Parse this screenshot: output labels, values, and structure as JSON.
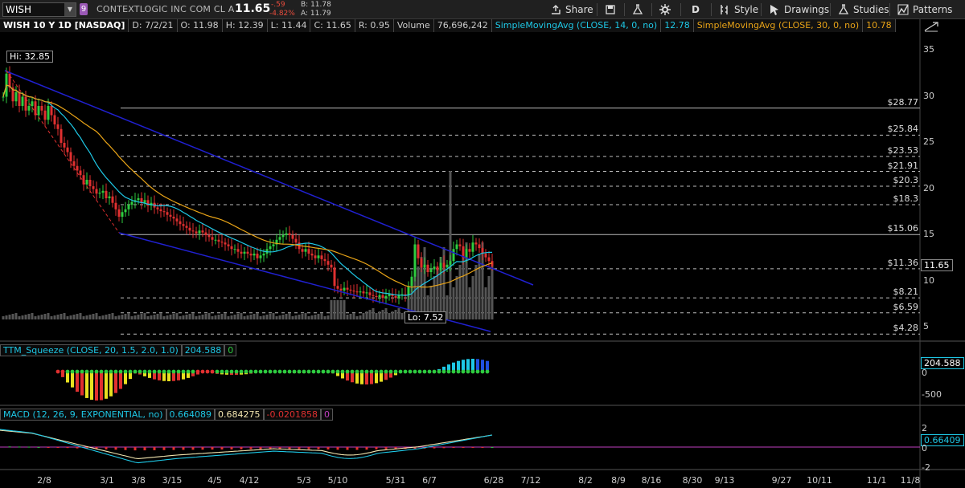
{
  "toolbar": {
    "symbol": "WISH",
    "link_badge": "9",
    "company": "CONTEXTLOGIC INC COM CL A",
    "last": "11.65",
    "change_abs": "-.59",
    "change_pct": "-4.82%",
    "bid": "B: 11.78",
    "ask": "A: 11.79",
    "share": "Share",
    "aggregation": "D",
    "style": "Style",
    "drawings": "Drawings",
    "studies": "Studies",
    "patterns": "Patterns"
  },
  "status": {
    "title": "WISH 10 Y 1D [NASDAQ]",
    "date": "D: 7/2/21",
    "open": "O: 11.98",
    "high": "H: 12.39",
    "low": "L: 11.44",
    "close": "C: 11.65",
    "range": "R: 0.95",
    "volume_label": "Volume",
    "volume_value": "76,696,242",
    "sma14_label": "SimpleMovingAvg (CLOSE, 14, 0, no)",
    "sma14_value": "12.78",
    "sma30_label": "SimpleMovingAvg (CLOSE, 30, 0, no)",
    "sma30_value": "10.78"
  },
  "price_panel": {
    "hi_label": "Hi: 32.85",
    "lo_label": "Lo: 7.52",
    "last_tag": "11.65",
    "y_ticks": [
      "35",
      "30",
      "25",
      "20",
      "15",
      "10",
      "5"
    ],
    "levels": [
      "$28.77",
      "$25.84",
      "$23.53",
      "$21.91",
      "$20.3",
      "$18.3",
      "$15.06",
      "$11.36",
      "$8.21",
      "$6.59",
      "$4.28"
    ]
  },
  "squeeze_panel": {
    "label": "TTM_Squeeze (CLOSE, 20, 1.5, 2.0, 1.0)",
    "value": "204.588",
    "zero_flag": "0",
    "tag": "204.588",
    "y_ticks": [
      "0",
      "-500"
    ]
  },
  "macd_panel": {
    "label": "MACD (12, 26, 9, EXPONENTIAL, no)",
    "value": "0.664089",
    "avg": "0.684275",
    "diff": "-0.0201858",
    "zero_flag": "0",
    "tag": "0.66409",
    "y_ticks": [
      "2",
      "0",
      "-2"
    ]
  },
  "x_axis": {
    "labels": [
      "2/8",
      "3/1",
      "3/8",
      "3/15",
      "4/5",
      "4/12",
      "5/3",
      "5/10",
      "5/31",
      "6/7",
      "6/28",
      "7/12",
      "8/2",
      "8/9",
      "8/16",
      "8/30",
      "9/13",
      "9/27",
      "10/11",
      "11/1",
      "11/8"
    ]
  },
  "colors": {
    "up": "#2ecc40",
    "down": "#e03030",
    "sma14": "#1ec8e6",
    "sma30": "#e8a317",
    "channel": "#2020d0"
  },
  "icons": [
    "share-icon",
    "save-icon",
    "flask-icon",
    "gear-icon",
    "style-icon",
    "cursor-icon",
    "studies-icon",
    "patterns-icon",
    "expand-icon"
  ]
}
